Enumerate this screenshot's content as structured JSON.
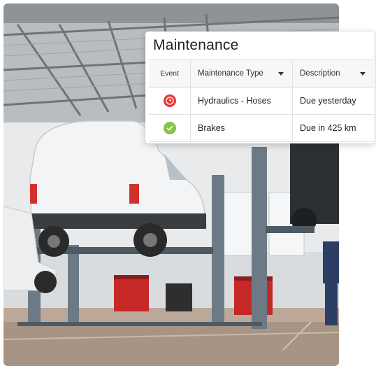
{
  "card": {
    "title": "Maintenance",
    "columns": [
      {
        "label": "Event",
        "sortable": false
      },
      {
        "label": "Maintenance Type",
        "sortable": true
      },
      {
        "label": "Description",
        "sortable": true
      }
    ],
    "rows": [
      {
        "event_icon": "clock-icon",
        "event_status": "overdue",
        "type": "Hydraulics - Hoses",
        "description": "Due yesterday"
      },
      {
        "event_icon": "check-icon",
        "event_status": "ok",
        "type": "Brakes",
        "description": "Due in 425 km"
      }
    ]
  },
  "colors": {
    "overdue": "#e53935",
    "ok": "#8bc34a",
    "header_bg": "#f7f7f7"
  },
  "background": {
    "image": "garage-photo",
    "description_icon": "vehicle-lift-photo"
  }
}
